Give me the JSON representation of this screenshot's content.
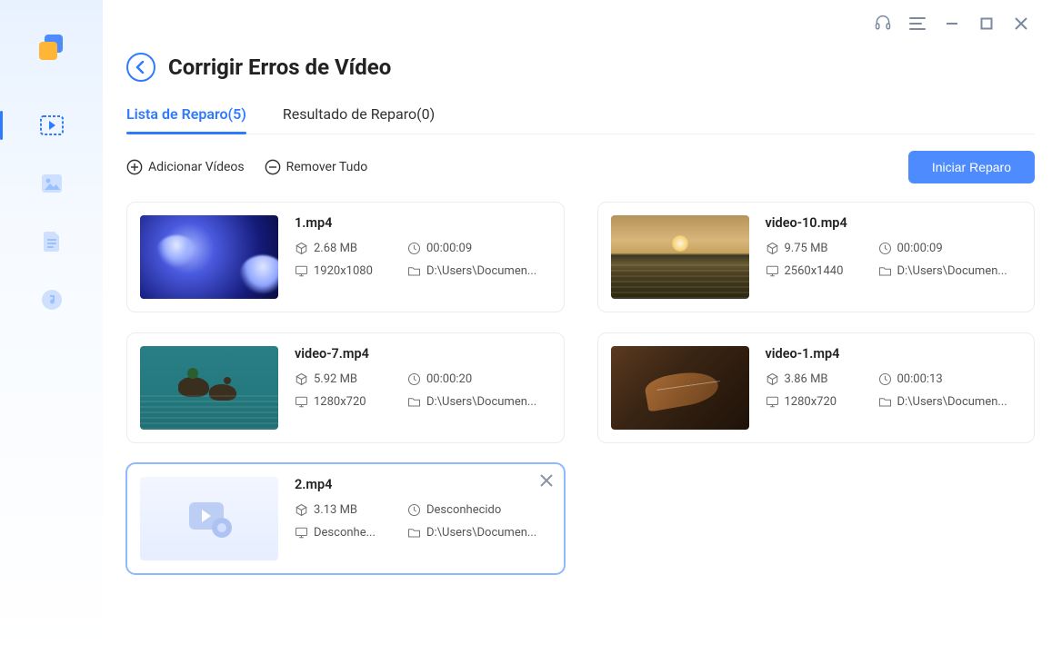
{
  "header": {
    "page_title": "Corrigir Erros de Vídeo"
  },
  "tabs": [
    {
      "label": "Lista de Reparo(5)",
      "active": true
    },
    {
      "label": "Resultado de Reparo(0)",
      "active": false
    }
  ],
  "toolbar": {
    "add_label": "Adicionar Vídeos",
    "remove_label": "Remover Tudo",
    "start_label": "Iniciar Reparo"
  },
  "videos": [
    {
      "name": "1.mp4",
      "size": "2.68 MB",
      "duration": "00:00:09",
      "resolution": "1920x1080",
      "path": "D:\\Users\\Documen...",
      "thumb": "jellyfish",
      "selected": false
    },
    {
      "name": "video-10.mp4",
      "size": "9.75 MB",
      "duration": "00:00:09",
      "resolution": "2560x1440",
      "path": "D:\\Users\\Documen...",
      "thumb": "sunset",
      "selected": false
    },
    {
      "name": "video-7.mp4",
      "size": "5.92 MB",
      "duration": "00:00:20",
      "resolution": "1280x720",
      "path": "D:\\Users\\Documen...",
      "thumb": "ducks",
      "selected": false
    },
    {
      "name": "video-1.mp4",
      "size": "3.86 MB",
      "duration": "00:00:13",
      "resolution": "1280x720",
      "path": "D:\\Users\\Documen...",
      "thumb": "guitar",
      "selected": false
    },
    {
      "name": "2.mp4",
      "size": "3.13 MB",
      "duration": "Desconhecido",
      "resolution": "Desconhe...",
      "path": "D:\\Users\\Documen...",
      "thumb": "placeholder",
      "selected": true
    }
  ]
}
